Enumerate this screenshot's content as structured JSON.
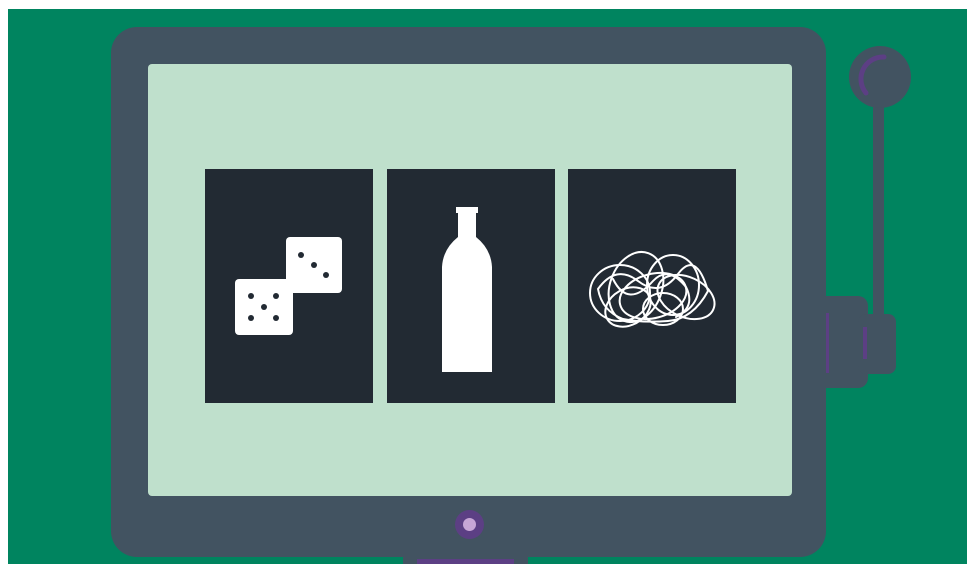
{
  "colors": {
    "background": "#00845f",
    "machine_body": "#425361",
    "screen": "#bfe0cc",
    "reel": "#222a33",
    "symbol": "#ffffff",
    "accent_purple": "#5c3f84",
    "indicator_light": "#c7a6d6"
  },
  "reels": [
    {
      "symbol": "dice-icon"
    },
    {
      "symbol": "bottle-icon"
    },
    {
      "symbol": "scribble-icon"
    }
  ]
}
